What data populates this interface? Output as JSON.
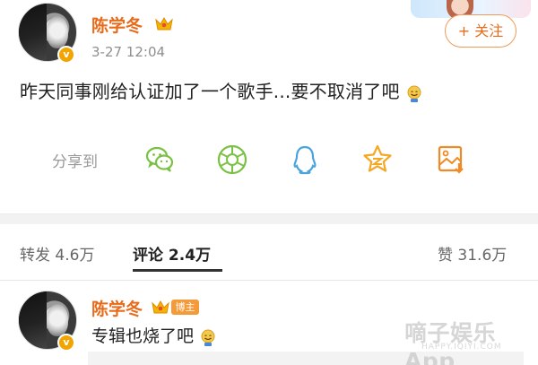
{
  "post": {
    "author": "陈学冬",
    "timestamp": "3-27 12:04",
    "follow_label": "+ 关注",
    "text": "昨天同事刚给认证加了一个歌手...要不取消了吧",
    "emoji": "smiling-sweat-emoji"
  },
  "share": {
    "label": "分享到",
    "targets": [
      "wechat-icon",
      "moments-icon",
      "qq-icon",
      "qzone-icon",
      "save-image-icon"
    ]
  },
  "tabs": {
    "repost": "转发 4.6万",
    "comments": "评论 2.4万",
    "likes": "赞 31.6万"
  },
  "comment": {
    "author": "陈学冬",
    "badge": "博主",
    "text": "专辑也烧了吧"
  },
  "watermark": {
    "text": "嘀子娱乐App",
    "sub": "HAPPY.IQIYI.COM"
  },
  "colors": {
    "username": "#e86b1a",
    "follow_border": "#f09a5a",
    "badge": "#f49a38",
    "verified": "#f2a400",
    "icon_green": "#7ac143",
    "icon_blue": "#4aa3df",
    "icon_yellow": "#f5a623",
    "icon_orange": "#f08a24"
  }
}
